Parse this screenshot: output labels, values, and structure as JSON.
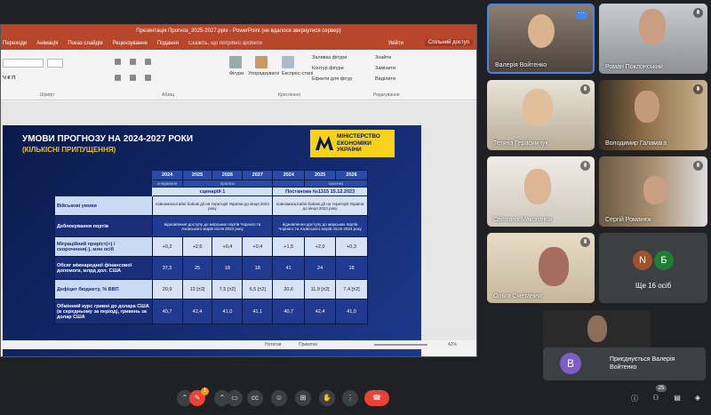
{
  "powerpoint": {
    "title": "Презентація Прогноз_2025-2027.pptx - PowerPoint (не вдалося звернутися сервер)",
    "tabs": [
      "Переходи",
      "Анімація",
      "Показ слайдів",
      "Рецензування",
      "Подання"
    ],
    "tell_me": "Скажіть, що потрібно зробити",
    "sign_in": "Увійти",
    "share": "Спільний доступ",
    "ribbon": {
      "groups": [
        "Шрифт",
        "Абзац",
        "Креслення",
        "Редагування"
      ],
      "labels": [
        "Фігури",
        "Упорядкувати",
        "Експрес-стилі",
        "Заливка фігури",
        "Контур фігури",
        "Ефекти для фігур",
        "Знайти",
        "Замінити",
        "Виділити"
      ]
    },
    "status": {
      "notes": "Нотатки",
      "comments": "Примітки",
      "zoom": "42%"
    }
  },
  "slide": {
    "title": "УМОВИ ПРОГНОЗУ НА 2024-2027 РОКИ",
    "subtitle": "(КІЛЬКІСНІ ПРИПУЩЕННЯ)",
    "logo_text": [
      "МІНІСТЕРСТВО",
      "ЕКОНОМІКИ",
      "УКРАЇНИ"
    ],
    "brand_color": "#f7d21b",
    "years": [
      "2024",
      "2025",
      "2026",
      "2027",
      "2024",
      "2025",
      "2026"
    ],
    "sub_header": [
      "очікування",
      "прогноз",
      "прогноз"
    ],
    "scenarios": [
      "сценарій 1",
      "Постанова №1315 15.12.2023"
    ],
    "rows": [
      {
        "label": "Військові умови",
        "left": "повномасштабні бойові дії на території України до кінця 2024 року",
        "right": "повномасштабні бойові дії на території України до кінця 2024 року"
      },
      {
        "label": "Деблокування портів",
        "left": "відновлення доступу до морських портів Чорного та Азовського морів після 2024 року",
        "right": "відновлення доступу до морських портів Чорного та Азовського морів після 2024 року"
      },
      {
        "label": "Міграційний приріст(+) / скорочення(-), млн осіб",
        "values": [
          "+0,2",
          "+2,6",
          "+0,4",
          "+0,4",
          "+1,5",
          "+2,0",
          "+0,3"
        ]
      },
      {
        "label": "Обсяг міжнародної фінансової допомоги, млрд дол. США",
        "values": [
          "37,5",
          "25",
          "18",
          "18",
          "41",
          "24",
          "18"
        ]
      },
      {
        "label": "Дефіцит бюджету, % ВВП",
        "values": [
          "20,9",
          "12 [±2]",
          "7,5 [±2]",
          "6,5 [±2]",
          "20,6",
          "11,9 [±2]",
          "7,4 [±2]"
        ]
      },
      {
        "label": "Обмінний курс гривні до долара США (в середньому за період), гривень за долар США",
        "values": [
          "40,7",
          "42,4",
          "41,0",
          "41,1",
          "40,7",
          "42,4",
          "41,0"
        ]
      }
    ]
  },
  "participants": [
    {
      "name": "Валерія Войтенко"
    },
    {
      "name": "Роман Поклонський"
    },
    {
      "name": "Тетяна Герасимчук"
    },
    {
      "name": "Володимир Галамага"
    },
    {
      "name": "Світлана Макогонюк"
    },
    {
      "name": "Сергій Романюк"
    },
    {
      "name": "Ольга Сметаніна"
    }
  ],
  "others": {
    "label": "Ще 16 осіб",
    "avatars": [
      "N",
      "Б"
    ]
  },
  "join_notice": {
    "avatar": "В",
    "text": "Приєднується Валерія Войтенко"
  },
  "controls": {
    "participant_count": "25",
    "raise_badge": "1"
  }
}
